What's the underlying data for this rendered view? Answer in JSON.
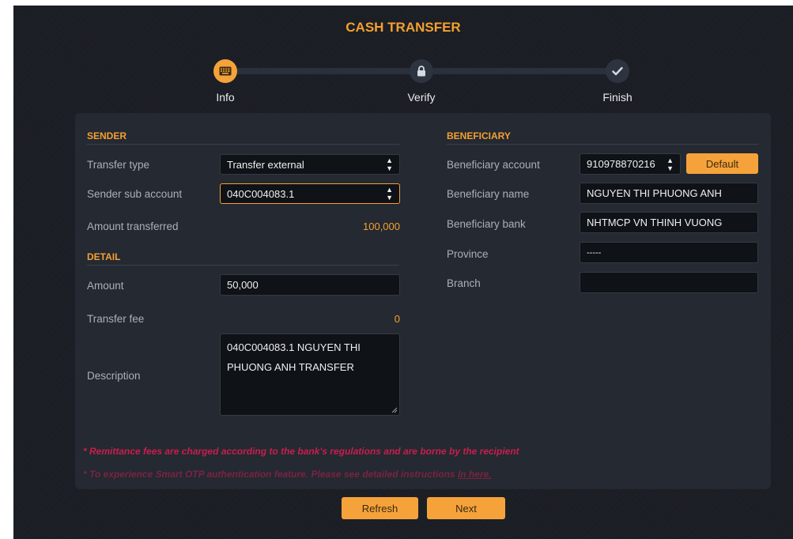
{
  "title": "CASH TRANSFER",
  "steps": [
    {
      "label": "Info",
      "icon": "keyboard-icon",
      "state": "active"
    },
    {
      "label": "Verify",
      "icon": "lock-icon",
      "state": "pending"
    },
    {
      "label": "Finish",
      "icon": "check-icon",
      "state": "pending"
    }
  ],
  "sender": {
    "heading": "SENDER",
    "transfer_type_label": "Transfer type",
    "transfer_type_value": "Transfer external",
    "sub_account_label": "Sender sub account",
    "sub_account_value": "040C004083.1",
    "amount_transferred_label": "Amount transferred",
    "amount_transferred_value": "100,000"
  },
  "detail": {
    "heading": "DETAIL",
    "amount_label": "Amount",
    "amount_value": "50,000",
    "fee_label": "Transfer fee",
    "fee_value": "0",
    "description_label": "Description",
    "description_line1": "040C004083.1 NGUYEN THI",
    "description_line2": "PHUONG ANH TRANSFER"
  },
  "beneficiary": {
    "heading": "BENEFICIARY",
    "account_label": "Beneficiary account",
    "account_value": "910978870216",
    "default_button": "Default",
    "name_label": "Beneficiary name",
    "name_value": "NGUYEN THI PHUONG ANH",
    "bank_label": "Beneficiary bank",
    "bank_value": "NHTMCP VN THINH VUONG",
    "province_label": "Province",
    "province_value": "-----",
    "branch_label": "Branch",
    "branch_value": ""
  },
  "notes": {
    "fee_note": "* Remittance fees are charged according to the bank's regulations and are borne by the recipient",
    "otp_note": "* To experience Smart OTP authentication feature. Please see detailed instructions",
    "otp_link": "In here."
  },
  "buttons": {
    "refresh": "Refresh",
    "next": "Next"
  },
  "colors": {
    "accent": "#f6a23a",
    "background": "#1c1f26",
    "card": "#242932",
    "note": "#c81e4b"
  }
}
